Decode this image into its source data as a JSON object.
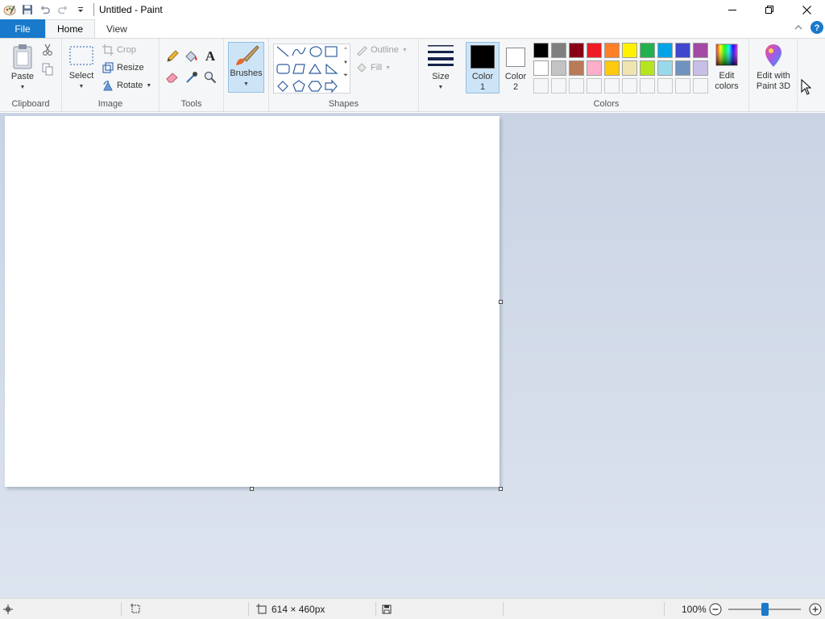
{
  "window": {
    "title": "Untitled - Paint",
    "icons": [
      "paint-icon",
      "save-icon",
      "undo-icon",
      "redo-icon",
      "customize-icon"
    ],
    "controls": [
      "minimize-icon",
      "restore-icon",
      "close-icon"
    ]
  },
  "tabs": [
    {
      "label": "File"
    },
    {
      "label": "Home",
      "active": true
    },
    {
      "label": "View"
    }
  ],
  "ribbon": {
    "clipboard": {
      "group_label": "Clipboard",
      "paste_label": "Paste"
    },
    "image": {
      "group_label": "Image",
      "select_label": "Select",
      "crop_label": "Crop",
      "resize_label": "Resize",
      "rotate_label": "Rotate"
    },
    "tools": {
      "group_label": "Tools"
    },
    "brushes": {
      "label": "Brushes"
    },
    "shapes": {
      "group_label": "Shapes",
      "outline_label": "Outline",
      "fill_label": "Fill"
    },
    "size": {
      "label": "Size"
    },
    "colors": {
      "group_label": "Colors",
      "color1_label": "Color",
      "color1_num": "1",
      "color2_label": "Color",
      "color2_num": "2",
      "color1_value": "#000000",
      "color2_value": "#ffffff",
      "edit_colors_line1": "Edit",
      "edit_colors_line2": "colors",
      "palette_row1": [
        "#000000",
        "#7f7f7f",
        "#880015",
        "#ed1c24",
        "#ff7f27",
        "#fff200",
        "#22b14c",
        "#00a2e8",
        "#3f48cc",
        "#a349a4"
      ],
      "palette_row2": [
        "#ffffff",
        "#c3c3c3",
        "#b97a57",
        "#ffaec9",
        "#ffc90e",
        "#efe4b0",
        "#b5e61d",
        "#99d9ea",
        "#7092be",
        "#c8bfe7"
      ],
      "custom_slots": 10
    },
    "paint3d": {
      "line1": "Edit with",
      "line2": "Paint 3D"
    }
  },
  "status": {
    "canvas_size": "614 × 460px",
    "zoom": "100%",
    "zoom_fraction": 0.5
  }
}
